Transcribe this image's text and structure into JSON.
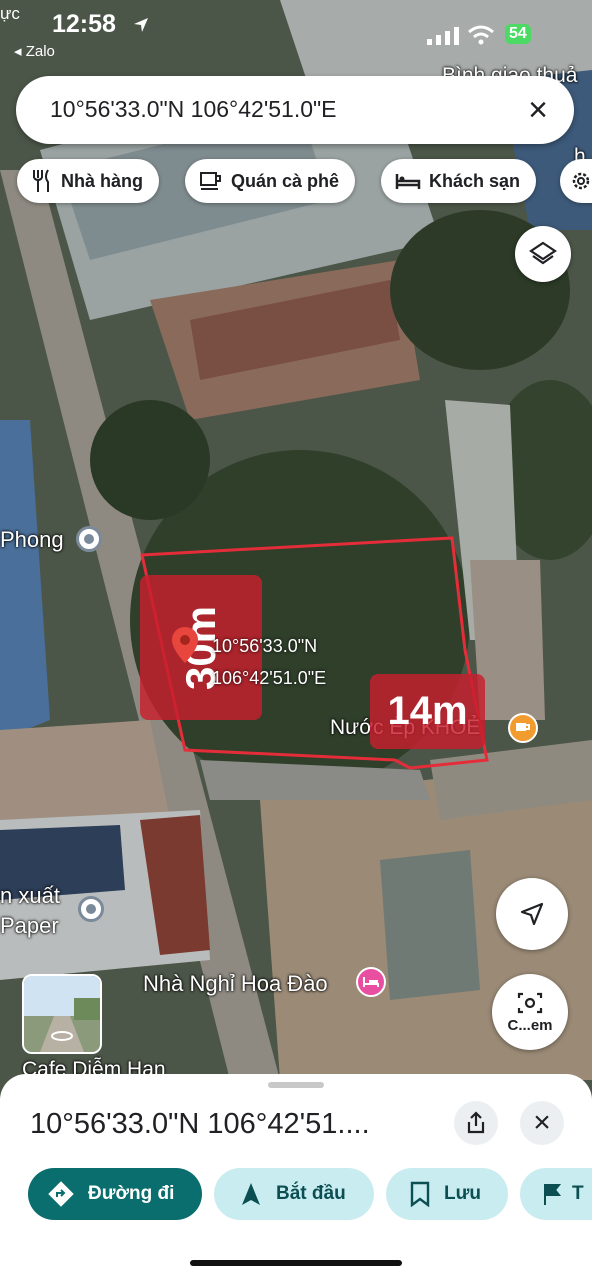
{
  "status_bar": {
    "corner_text": "ực",
    "time": "12:58",
    "back_app": "◂ Zalo",
    "battery": "54"
  },
  "search": {
    "query": "10°56'33.0\"N 106°42'51.0\"E",
    "clear_icon": "close-icon"
  },
  "chips": [
    {
      "label": "Nhà hàng",
      "icon": "restaurant-icon"
    },
    {
      "label": "Quán cà phê",
      "icon": "coffee-icon"
    },
    {
      "label": "Khách sạn",
      "icon": "hotel-icon"
    }
  ],
  "map": {
    "top_right_label_1": "Bình giao thuả",
    "top_right_label_2": "h",
    "place_left": "Phong",
    "pin_coords_lat": "10°56'33.0\"N",
    "pin_coords_lng": "106°42'51.0\"E",
    "place_juice": "Nước Ép KHOẺ",
    "place_paper_1": "n xuất",
    "place_paper_2": "Paper",
    "place_hotel": "Nhà Nghỉ Hoa Đào",
    "place_bottom": "Cafe Diễm Hạn",
    "measure_height": "30m",
    "measure_width": "14m",
    "camera_label": "C...em"
  },
  "sheet": {
    "title": "10°56'33.0\"N 106°42'51....",
    "actions": [
      {
        "label": "Đường đi",
        "icon": "directions-icon"
      },
      {
        "label": "Bắt đầu",
        "icon": "navigation-icon"
      },
      {
        "label": "Lưu",
        "icon": "bookmark-icon"
      },
      {
        "label": "T",
        "icon": "flag-icon"
      }
    ]
  },
  "colors": {
    "accent_teal": "#0b6e6e",
    "chip_teal_bg": "#c9ecf0",
    "measure_red": "#c81e2d"
  }
}
